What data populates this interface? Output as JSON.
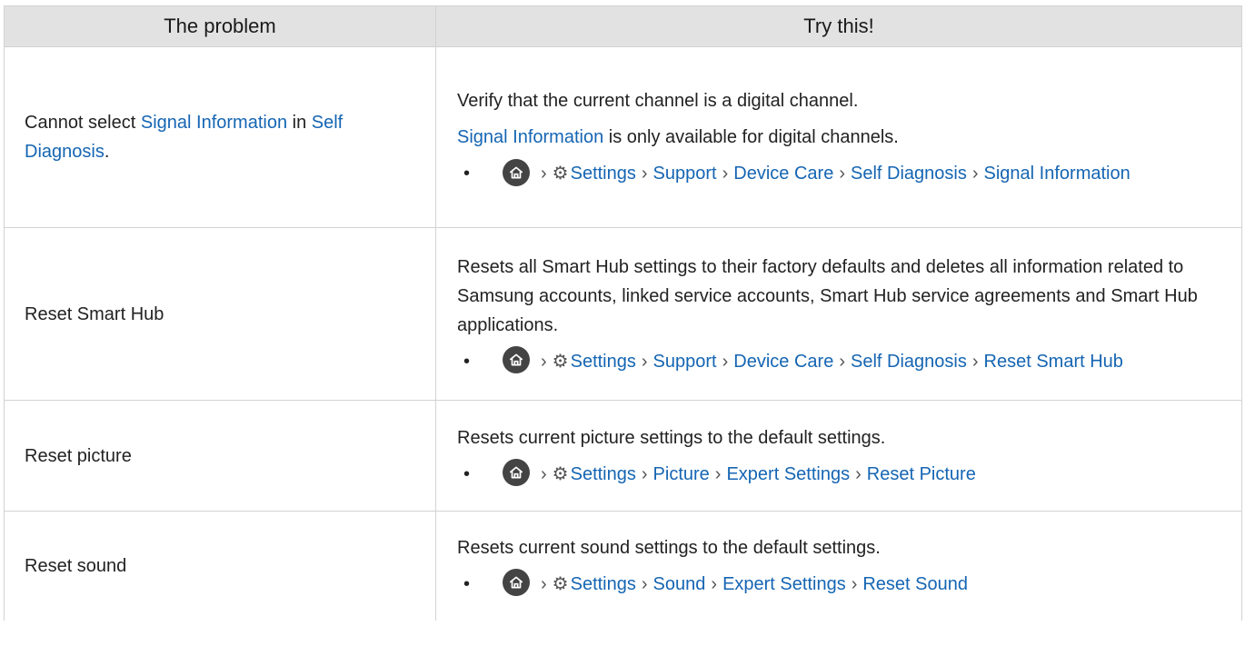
{
  "header": {
    "problem": "The problem",
    "solution": "Try this!"
  },
  "rows": [
    {
      "problem_prefix": "Cannot select ",
      "problem_link1": "Signal Information",
      "problem_mid": " in ",
      "problem_link2": "Self Diagnosis",
      "problem_suffix": ".",
      "line1": "Verify that the current channel is a digital channel.",
      "line2_link": "Signal Information",
      "line2_rest": " is only available for digital channels.",
      "path": [
        "Settings",
        "Support",
        "Device Care",
        "Self Diagnosis",
        "Signal Information"
      ]
    },
    {
      "problem": "Reset Smart Hub",
      "line1": "Resets all Smart Hub settings to their factory defaults and deletes all information related to Samsung accounts, linked service accounts, Smart Hub service agreements and Smart Hub applications.",
      "path": [
        "Settings",
        "Support",
        "Device Care",
        "Self Diagnosis",
        "Reset Smart Hub"
      ]
    },
    {
      "problem": "Reset picture",
      "line1": "Resets current picture settings to the default settings.",
      "path": [
        "Settings",
        "Picture",
        "Expert Settings",
        "Reset Picture"
      ]
    },
    {
      "problem": "Reset sound",
      "line1": "Resets current sound settings to the default settings.",
      "path": [
        "Settings",
        "Sound",
        "Expert Settings",
        "Reset Sound"
      ]
    }
  ],
  "icons": {
    "home": "home-icon",
    "gear": "gear-icon",
    "chevron": "chevron-right-icon",
    "bullet": "bullet-icon"
  },
  "colors": {
    "link": "#1565b3",
    "header_bg": "#e2e2e2",
    "home_icon_bg": "#444444"
  }
}
